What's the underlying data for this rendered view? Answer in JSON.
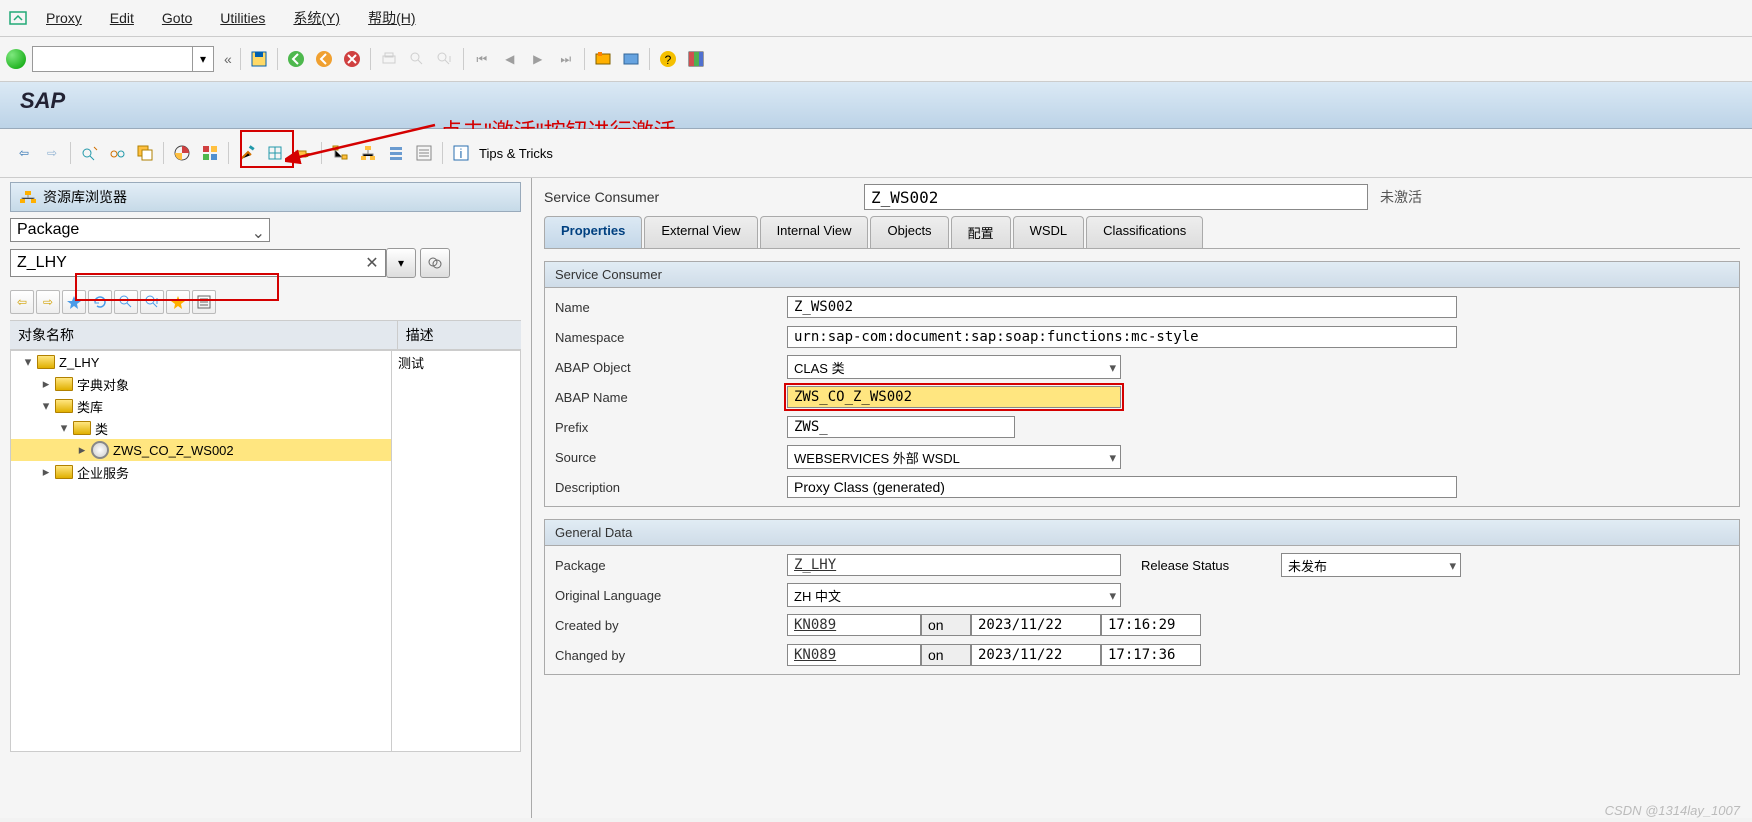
{
  "menu": {
    "items": [
      "Proxy",
      "Edit",
      "Goto",
      "Utilities",
      "系统(Y)",
      "帮助(H)"
    ]
  },
  "title": "SAP",
  "annotation": "点击\"激活\"按钮进行激活",
  "tips": "Tips & Tricks",
  "repo_browser_title": "资源库浏览器",
  "package_dropdown": "Package",
  "package_value": "Z_LHY",
  "tree_headers": {
    "col1": "对象名称",
    "col2": "描述"
  },
  "tree": {
    "root": "Z_LHY",
    "root_desc": "测试",
    "n1": "字典对象",
    "n2": "类库",
    "n3": "类",
    "n4": "ZWS_CO_Z_WS002",
    "n5": "企业服务"
  },
  "service_consumer_label": "Service Consumer",
  "service_consumer_value": "Z_WS002",
  "status": "未激活",
  "tabs": [
    "Properties",
    "External View",
    "Internal View",
    "Objects",
    "配置",
    "WSDL",
    "Classifications"
  ],
  "group1": {
    "title": "Service Consumer",
    "name_label": "Name",
    "name_value": "Z_WS002",
    "ns_label": "Namespace",
    "ns_value": "urn:sap-com:document:sap:soap:functions:mc-style",
    "ao_label": "ABAP Object",
    "ao_value": "CLAS 类",
    "an_label": "ABAP Name",
    "an_value": "ZWS_CO_Z_WS002",
    "prefix_label": "Prefix",
    "prefix_value": "ZWS_",
    "source_label": "Source",
    "source_value": "WEBSERVICES 外部 WSDL",
    "desc_label": "Description",
    "desc_value": "Proxy Class (generated)"
  },
  "group2": {
    "title": "General Data",
    "pkg_label": "Package",
    "pkg_value": "Z_LHY",
    "rel_label": "Release Status",
    "rel_value": "未发布",
    "lang_label": "Original Language",
    "lang_value": "ZH 中文",
    "created_label": "Created by",
    "created_by": "KN089",
    "on_label": "on",
    "created_date": "2023/11/22",
    "created_time": "17:16:29",
    "changed_label": "Changed by",
    "changed_by": "KN089",
    "changed_date": "2023/11/22",
    "changed_time": "17:17:36"
  },
  "watermark": "CSDN @1314lay_1007"
}
